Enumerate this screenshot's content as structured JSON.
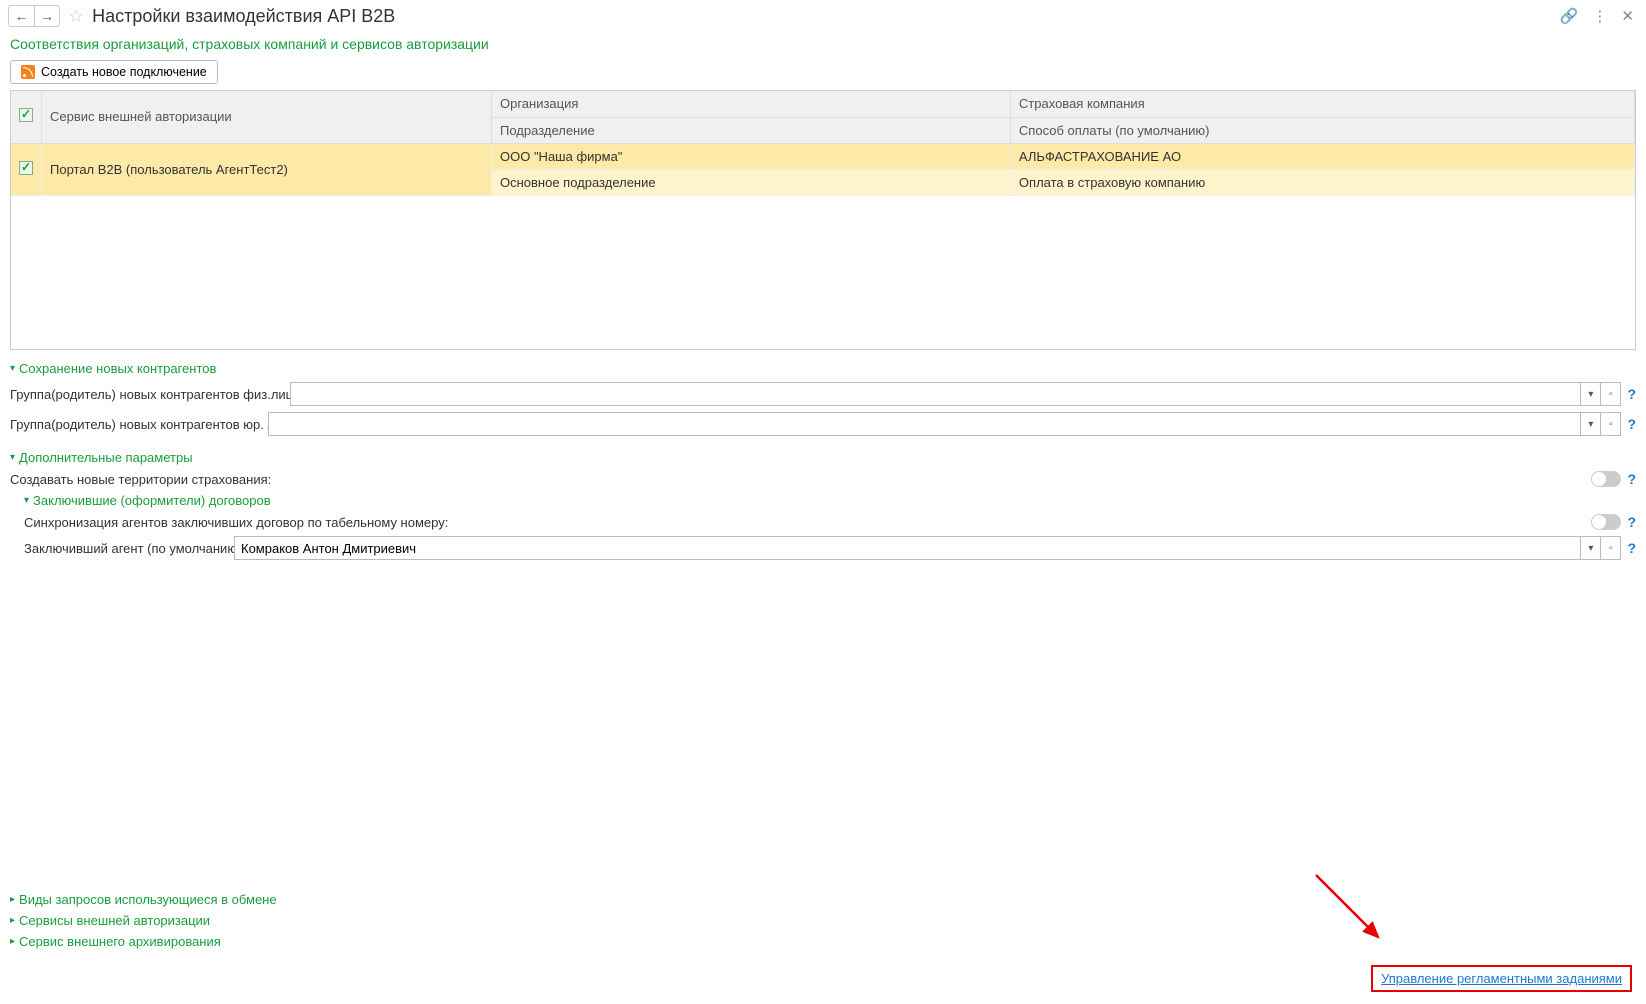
{
  "header": {
    "title": "Настройки взаимодействия API B2B"
  },
  "subtitle": "Соответствия организаций, страховых компаний и сервисов авторизации",
  "toolbar": {
    "create_label": "Создать новое подключение"
  },
  "table": {
    "headers": {
      "service": "Сервис внешней авторизации",
      "org": "Организация",
      "subdivision": "Подразделение",
      "company": "Страховая компания",
      "payment": "Способ оплаты (по умолчанию)"
    },
    "rows": [
      {
        "checked": true,
        "service": "Портал B2B (пользователь АгентТест2)",
        "org": "ООО \"Наша фирма\"",
        "subdivision": "Основное подразделение",
        "company": "АЛЬФАСТРАХОВАНИЕ АО",
        "payment": "Оплата в страховую компанию"
      }
    ]
  },
  "groups": {
    "save_contragents": {
      "title": "Сохранение новых контрагентов",
      "fields": {
        "group_phys_label": "Группа(родитель) новых контрагентов физ.лиц и ИП:",
        "group_phys_value": "",
        "group_jur_label": "Группа(родитель) новых контрагентов юр. лиц:",
        "group_jur_value": ""
      }
    },
    "extra_params": {
      "title": "Дополнительные параметры",
      "create_territories_label": "Создавать новые территории страхования:",
      "create_territories_value": false,
      "subgroup": {
        "title": "Заключившие (оформители) договоров",
        "sync_agents_label": "Синхронизация агентов заключивших договор по табельному номеру:",
        "sync_agents_value": false,
        "default_agent_label": "Заключивший агент (по умолчанию):",
        "default_agent_value": "Комраков Антон Дмитриевич"
      }
    },
    "collapsed": {
      "request_types": "Виды запросов использующиеся в обмене",
      "auth_services": "Сервисы внешней авторизации",
      "archive_service": "Сервис внешнего архивирования"
    }
  },
  "footer": {
    "link": "Управление регламентными заданиями"
  },
  "help": "?"
}
